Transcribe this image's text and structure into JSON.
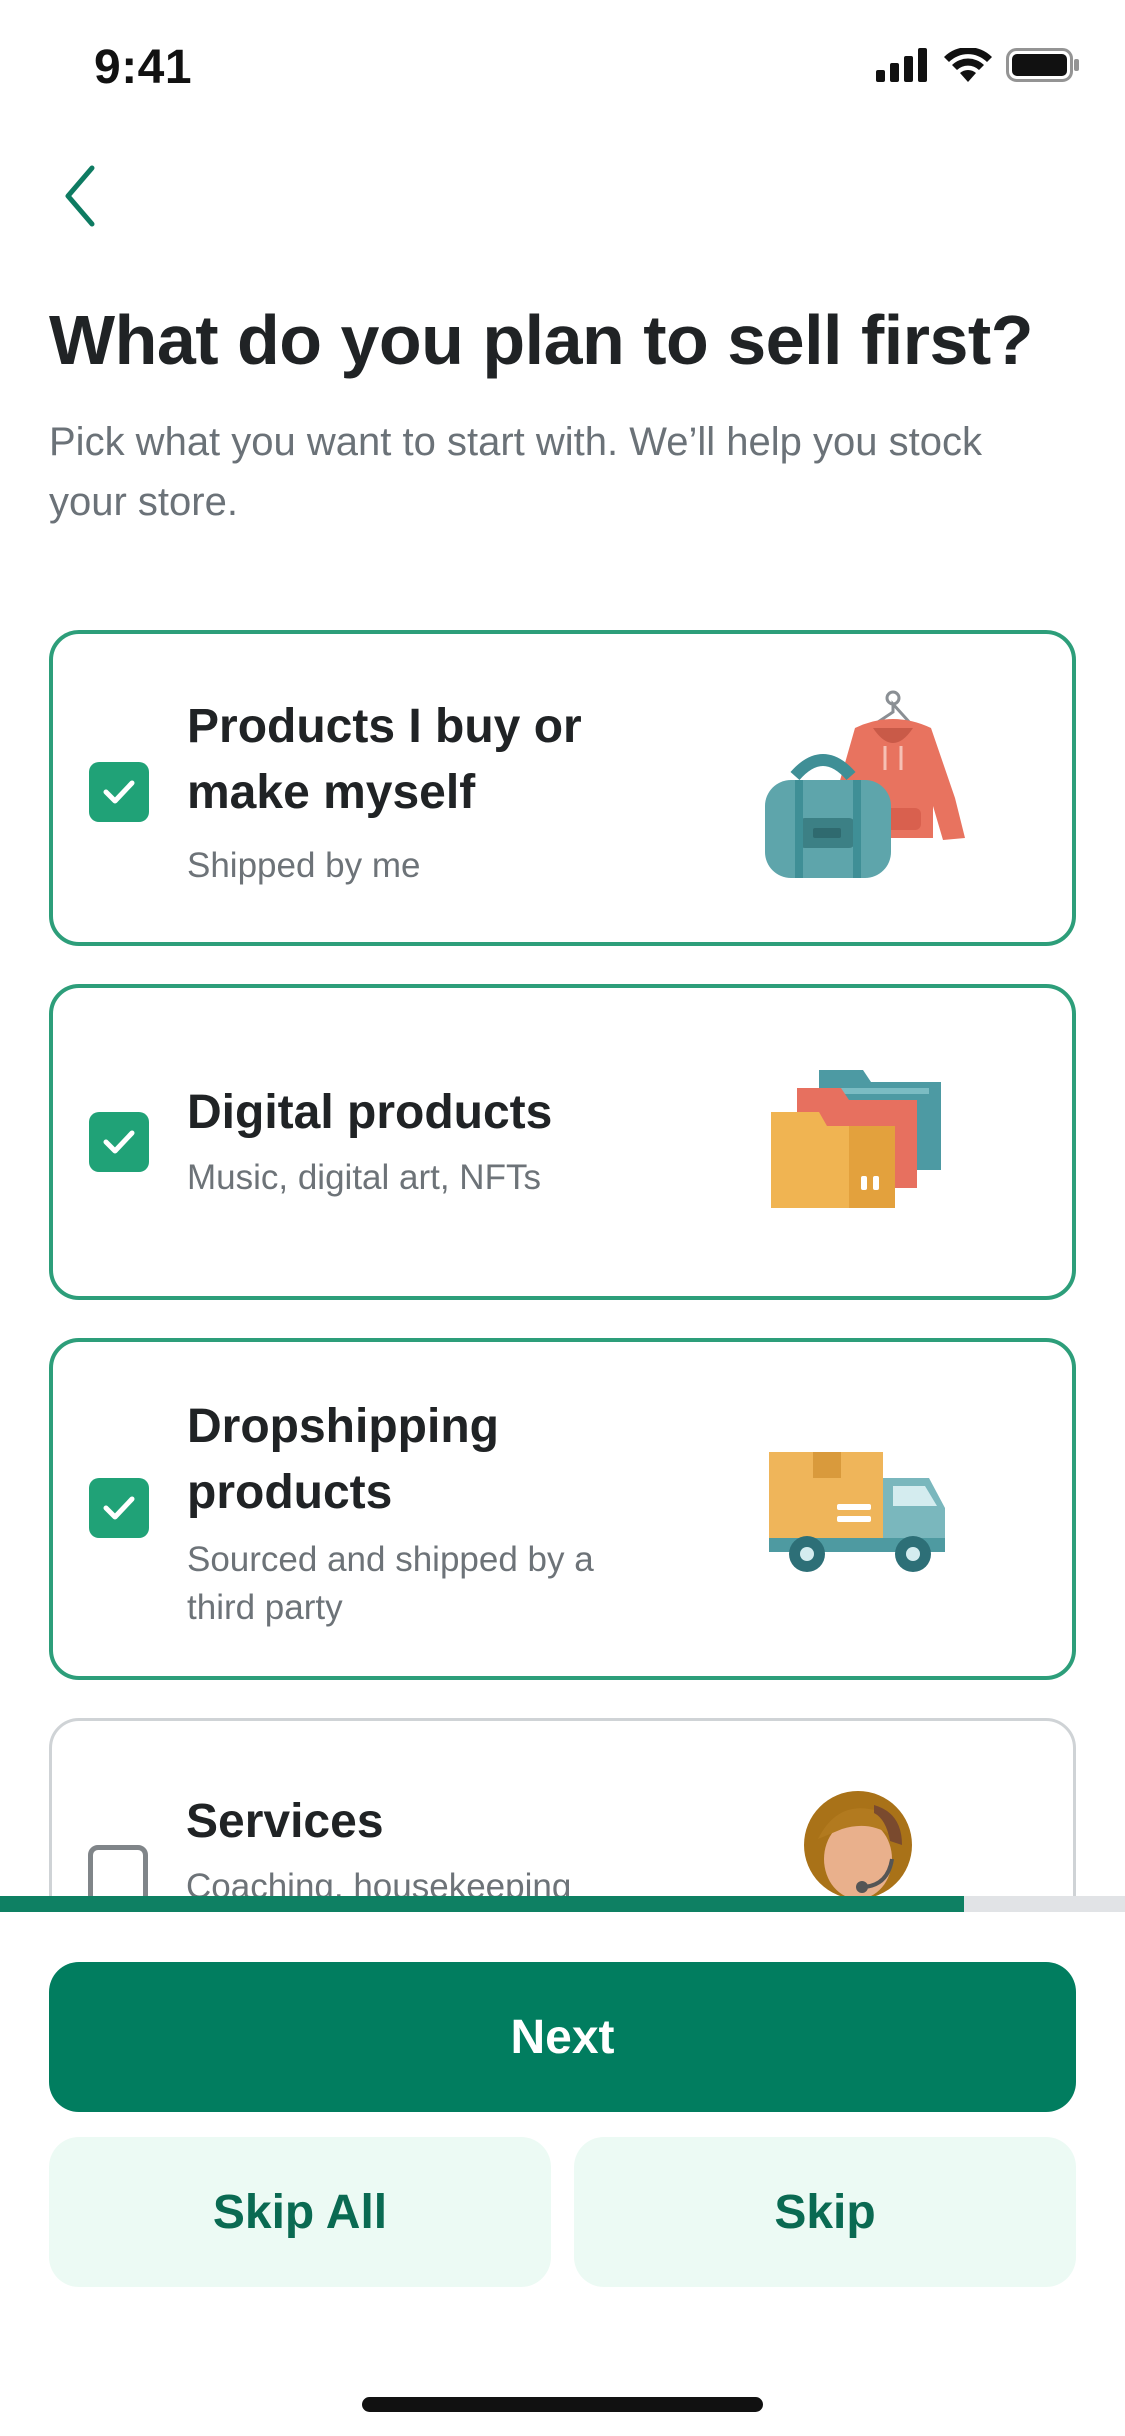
{
  "status_bar": {
    "time": "9:41",
    "icons": [
      "cellular-signal-icon",
      "wifi-icon",
      "battery-icon"
    ]
  },
  "navigation": {
    "back_icon": "chevron-left-icon"
  },
  "header": {
    "title": "What do you plan to sell first?",
    "subtitle": "Pick what you want to start with. We’ll help you stock your store."
  },
  "options": [
    {
      "title": "Products I buy or make myself",
      "description": "Shipped by me",
      "selected": true,
      "illustration": "bag-and-hoodie-illustration"
    },
    {
      "title": "Digital products",
      "description": "Music, digital art, NFTs",
      "selected": true,
      "illustration": "folders-illustration"
    },
    {
      "title": "Dropshipping products",
      "description": "Sourced and shipped by a third party",
      "selected": true,
      "illustration": "delivery-truck-illustration"
    },
    {
      "title": "Services",
      "description": "Coaching, housekeeping",
      "selected": false,
      "illustration": "support-agent-illustration"
    }
  ],
  "progress": {
    "fraction": 0.857
  },
  "actions": {
    "next_label": "Next",
    "skip_all_label": "Skip All",
    "skip_label": "Skip"
  },
  "colors": {
    "primary": "#017d5f",
    "selected_border": "#2d9e7a",
    "checkbox_fill": "#20a277",
    "secondary_button_bg": "#ecfaf4",
    "secondary_button_text": "#0a6a52"
  }
}
